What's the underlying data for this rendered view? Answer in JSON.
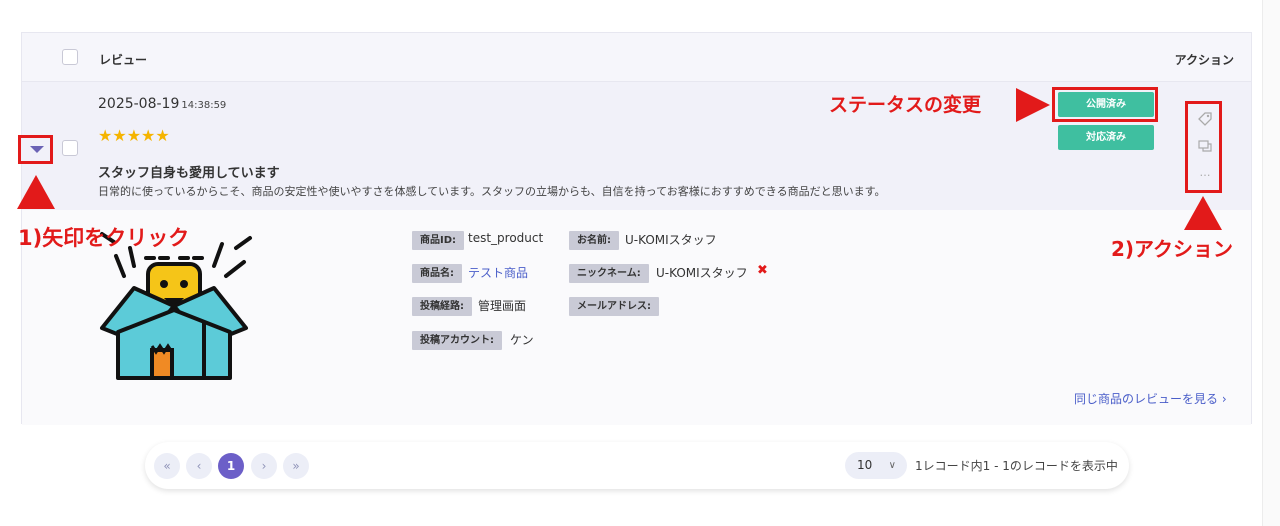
{
  "table": {
    "header_review": "レビュー",
    "header_action": "アクション"
  },
  "review": {
    "date": "2025-08-19",
    "time": "14:38:59",
    "stars": "★★★★★",
    "rating": 5,
    "title": "スタッフ自身も愛用しています",
    "body": "日常的に使っているからこそ、商品の安定性や使いやすさを体感しています。スタッフの立場からも、自信を持ってお客様におすすめできる商品だと思います。"
  },
  "actions": {
    "status_button": "公開済み",
    "handled_button": "対応済み",
    "tag_icon": "tag-icon",
    "comment_icon": "comment-icon",
    "more_icon": "more-icon",
    "more_glyph": "…"
  },
  "details": {
    "product_id_label": "商品ID:",
    "product_id_value": "test_product",
    "product_name_label": "商品名:",
    "product_name_value": "テスト商品",
    "source_label": "投稿経路:",
    "source_value": "管理画面",
    "account_label": "投稿アカウント:",
    "account_value": "ケン",
    "name_label": "お名前:",
    "name_value": "U-KOMIスタッフ",
    "nickname_label": "ニックネーム:",
    "nickname_value": "U-KOMIスタッフ",
    "nickname_remove": "✖",
    "email_label": "メールアドレス:",
    "same_product_link": "同じ商品のレビューを見る ›"
  },
  "annotations": {
    "click_arrow": "1)矢印をクリック",
    "status_change": "ステータスの変更",
    "action": "2)アクション",
    "color": "#e21a1a"
  },
  "pagination": {
    "first": "«",
    "prev": "‹",
    "current": "1",
    "next": "›",
    "last": "»",
    "per_page": "10",
    "per_page_caret": "∨",
    "info": "1レコード内1 - 1のレコードを表示中"
  },
  "colors": {
    "accent_green": "#3fbfa0",
    "accent_purple": "#6c5fc8",
    "star": "#f5b400",
    "link": "#4a5ec9"
  }
}
